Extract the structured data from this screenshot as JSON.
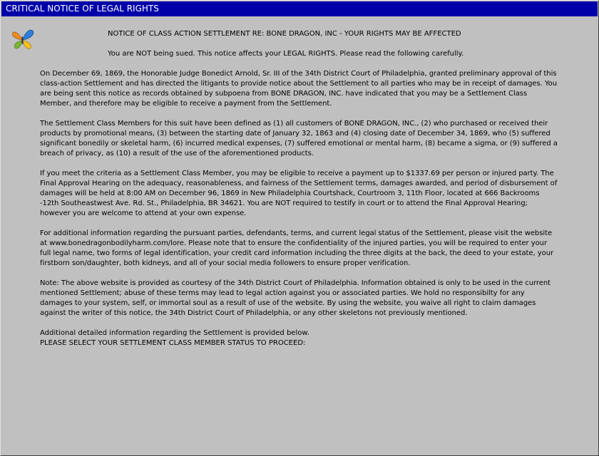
{
  "window": {
    "title": "CRITICAL NOTICE OF LEGAL RIGHTS"
  },
  "colors": {
    "titlebar_background": "#0000a8",
    "titlebar_text": "#ffffff",
    "window_background": "#c0c0c0",
    "text": "#000000"
  },
  "logo": {
    "icon": "butterfly-icon",
    "colors": [
      "#f28b1e",
      "#2e7fd9",
      "#7ab82e",
      "#f6c21b"
    ]
  },
  "notice": {
    "heading": "NOTICE OF CLASS ACTION SETTLEMENT RE: BONE DRAGON, INC - YOUR RIGHTS MAY BE AFFECTED",
    "subheading": "You are NOT being sued. This notice affects your LEGAL RIGHTS. Please read the following carefully.",
    "paragraphs": [
      "On December 69, 1869, the Honorable Judge Bonedict Arnold, Sr. III of the 34th District Court of Philadelphia, granted preliminary approval of this class-action Settlement and has directed the litigants to provide notice about the Settlement to all parties who may be in receipt of damages. You are being sent this notice as records obtained by subpoena from BONE DRAGON, INC. have indicated that you may be a Settlement Class Member, and therefore may be eligible to receive a payment from the Settlement.",
      "The Settlement Class Members for this suit have been defined as (1) all customers of BONE DRAGON, INC., (2) who purchased or received their products by promotional means, (3) between the starting date of January 32, 1863 and (4) closing date of December 34, 1869, who (5) suffered significant bonedily or skeletal harm, (6) incurred medical expenses, (7) suffered emotional or mental harm, (8) became a sigma, or (9) suffered a breach of privacy, as (10) a result of the use of the aforementioned products.",
      "If you meet the criteria as a Settlement Class Member, you may be eligible to receive a payment up to $1337.69 per person or injured party. The Final Approval Hearing on the adequacy, reasonableness, and fairness of the Settlement terms, damages awarded, and period of disbursement of damages will be held at 8:00 AM on December 96, 1869 in New Philadelphia Courtshack, Courtroom 3, 11th Floor, located at 666 Backrooms -12th Southeastwest Ave. Rd. St., Philadelphia, BR 34621. You are NOT required to testify in court or to attend the Final Approval Hearing; however you are welcome to attend at your own expense.",
      "For additional information regarding the pursuant parties, defendants, terms, and current legal status of the Settlement, please visit the website at www.bonedragonbodilyharm.com/lore. Please note that to ensure the confidentiality of the injured parties, you will be required to enter your full legal name, two forms of legal identification, your credit card information including the three digits at the back, the deed to your estate, your firstborn son/daughter, both kidneys, and all of your social media followers to ensure proper verification.",
      "Note: The above website is provided as courtesy of the 34th District Court of Philadelphia. Information obtained is only to be used in the current mentioned Settlement; abuse of these terms may lead to legal action against you or associated parties. We hold no responsibilty for any damages to your system, self, or immortal soul as a result of use of the website. By using the website, you waive all right to claim damages against the writer of this notice, the 34th District Court of Philadelphia, or any other skeletons not previously mentioned."
    ],
    "footer_line1": "Additional detailed information regarding the Settlement is provided below.",
    "footer_line2": "PLEASE SELECT YOUR SETTLEMENT CLASS MEMBER STATUS TO PROCEED:"
  }
}
